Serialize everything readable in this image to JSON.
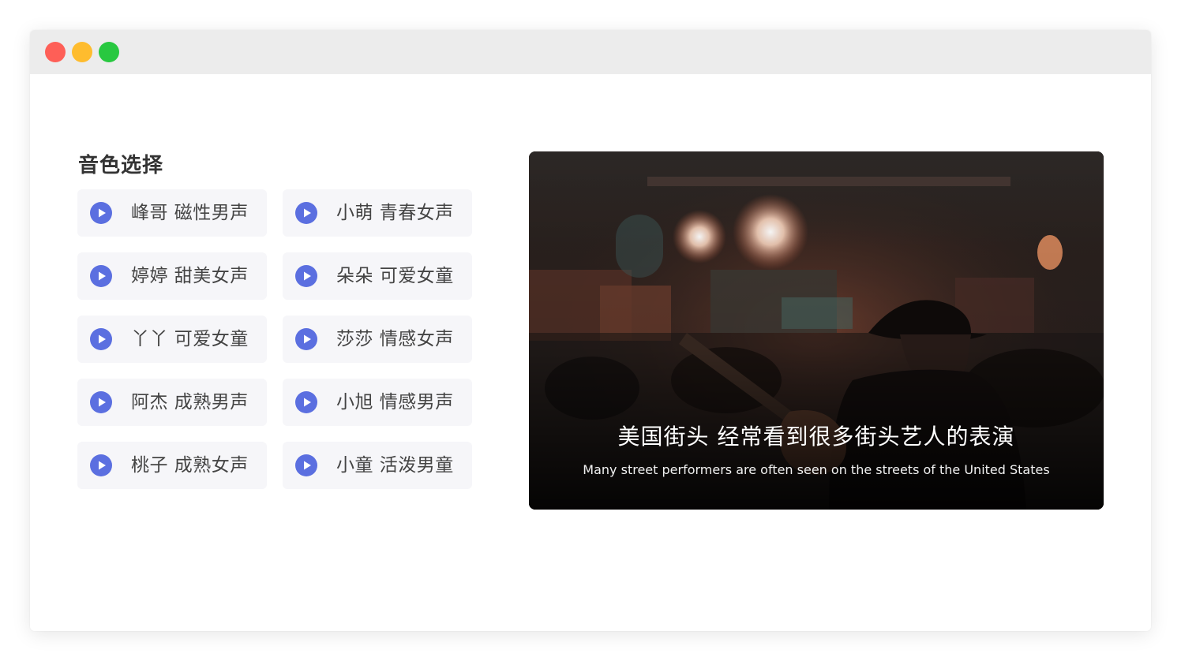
{
  "window": {
    "controls": [
      {
        "name": "close",
        "color": "#fe5f57"
      },
      {
        "name": "minimize",
        "color": "#febc2e"
      },
      {
        "name": "zoom",
        "color": "#28c840"
      }
    ]
  },
  "voice_section": {
    "title": "音色选择",
    "accent_color": "#5b6fe0",
    "voices": [
      {
        "label": "峰哥 磁性男声"
      },
      {
        "label": "小萌 青春女声"
      },
      {
        "label": "婷婷 甜美女声"
      },
      {
        "label": "朵朵 可爱女童"
      },
      {
        "label": "丫丫 可爱女童"
      },
      {
        "label": "莎莎 情感女声"
      },
      {
        "label": "阿杰 成熟男声"
      },
      {
        "label": "小旭 情感男声"
      },
      {
        "label": "桃子 成熟女声"
      },
      {
        "label": "小童 活泼男童"
      }
    ]
  },
  "media": {
    "caption_zh": "美国街头 经常看到很多街头艺人的表演",
    "caption_en": "Many street performers are often seen on the streets of the United States"
  }
}
